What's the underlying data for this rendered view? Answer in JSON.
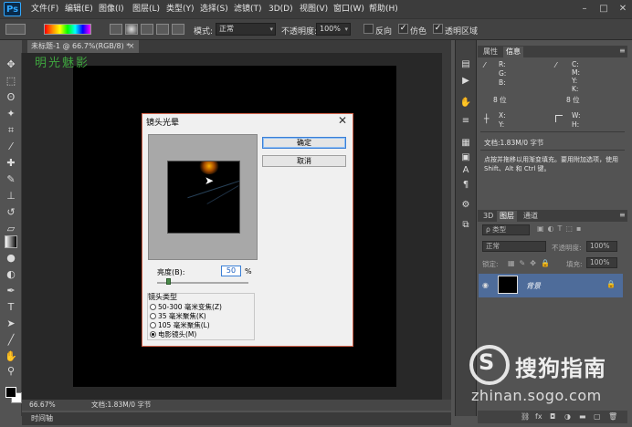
{
  "app": {
    "logo": "Ps"
  },
  "menu": [
    "文件(F)",
    "编辑(E)",
    "图像(I)",
    "图层(L)",
    "类型(Y)",
    "选择(S)",
    "滤镜(T)",
    "3D(D)",
    "视图(V)",
    "窗口(W)",
    "帮助(H)"
  ],
  "window_controls": {
    "minimize": "–",
    "restore": "□",
    "close": "✕"
  },
  "options_bar": {
    "mode_label": "模式:",
    "mode_value": "正常",
    "opacity_label": "不透明度:",
    "opacity_value": "100%",
    "reverse_label": "反向",
    "dither_label": "仿色",
    "transparency_label": "透明区域",
    "reverse_checked": false,
    "dither_checked": true,
    "transparency_checked": true
  },
  "document": {
    "tab_title": "未标题-1 @ 66.7%(RGB/8) *",
    "tab_close": "×",
    "zoom": "66.67%",
    "status": "文档:1.83M/0 字节",
    "timeline": "时间轴",
    "watermark": "明光魅影"
  },
  "dialog": {
    "title": "镜头光晕",
    "close": "✕",
    "ok_label": "确定",
    "cancel_label": "取消",
    "brightness_label": "亮度(B):",
    "brightness_value": "50",
    "brightness_unit": "%",
    "lens_type_label": "镜头类型",
    "lens_options": [
      {
        "label": "50-300 毫米变焦(Z)",
        "selected": false
      },
      {
        "label": "35 毫米聚焦(K)",
        "selected": false
      },
      {
        "label": "105 毫米聚焦(L)",
        "selected": false
      },
      {
        "label": "电影镜头(M)",
        "selected": true
      }
    ]
  },
  "info_panel": {
    "tabs": [
      "属性",
      "信息"
    ],
    "active_tab": "信息",
    "left_channels": "R:\nG:\nB:",
    "right_channels": "C:\nM:\nY:\nK:",
    "left_bits": "8 位",
    "right_bits": "8 位",
    "xy": "X:\nY:",
    "wh": "W:\nH:",
    "doc_size": "文档:1.83M/0 字节",
    "hint": "点按并拖移以用渐变填充。要用附加选项，使用 Shift、Alt 和 Ctrl 键。"
  },
  "layers_panel": {
    "tabs": [
      "3D",
      "图层",
      "通道"
    ],
    "active_tab": "图层",
    "filter_label": "ρ 类型",
    "blend_mode": "正常",
    "opacity_label": "不透明度:",
    "opacity_value": "100%",
    "lock_label": "锁定:",
    "fill_label": "填充:",
    "fill_value": "100%",
    "layer_name": "背景"
  },
  "watermark_logo": {
    "brand": "搜狗指南",
    "url": "zhinan.sogo.com"
  }
}
